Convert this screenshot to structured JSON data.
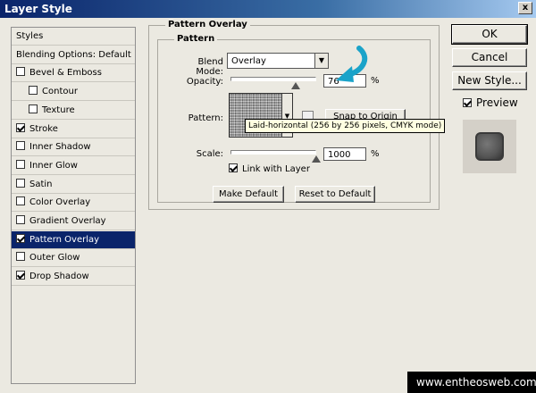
{
  "window": {
    "title": "Layer Style",
    "close_glyph": "x"
  },
  "style_list": {
    "items": [
      {
        "label": "Styles",
        "checkbox": false,
        "checked": false,
        "indent": false,
        "selected": false
      },
      {
        "label": "Blending Options: Default",
        "checkbox": false,
        "checked": false,
        "indent": false,
        "selected": false
      },
      {
        "label": "Bevel & Emboss",
        "checkbox": true,
        "checked": false,
        "indent": false,
        "selected": false
      },
      {
        "label": "Contour",
        "checkbox": true,
        "checked": false,
        "indent": true,
        "selected": false
      },
      {
        "label": "Texture",
        "checkbox": true,
        "checked": false,
        "indent": true,
        "selected": false
      },
      {
        "label": "Stroke",
        "checkbox": true,
        "checked": true,
        "indent": false,
        "selected": false
      },
      {
        "label": "Inner Shadow",
        "checkbox": true,
        "checked": false,
        "indent": false,
        "selected": false
      },
      {
        "label": "Inner Glow",
        "checkbox": true,
        "checked": false,
        "indent": false,
        "selected": false
      },
      {
        "label": "Satin",
        "checkbox": true,
        "checked": false,
        "indent": false,
        "selected": false
      },
      {
        "label": "Color Overlay",
        "checkbox": true,
        "checked": false,
        "indent": false,
        "selected": false
      },
      {
        "label": "Gradient Overlay",
        "checkbox": true,
        "checked": false,
        "indent": false,
        "selected": false
      },
      {
        "label": "Pattern Overlay",
        "checkbox": true,
        "checked": true,
        "indent": false,
        "selected": true
      },
      {
        "label": "Outer Glow",
        "checkbox": true,
        "checked": false,
        "indent": false,
        "selected": false
      },
      {
        "label": "Drop Shadow",
        "checkbox": true,
        "checked": true,
        "indent": false,
        "selected": false
      }
    ]
  },
  "panel": {
    "section_title": "Pattern Overlay",
    "group_title": "Pattern",
    "blend_mode": {
      "label": "Blend Mode:",
      "value": "Overlay"
    },
    "opacity": {
      "label": "Opacity:",
      "value": "76",
      "unit": "%",
      "level": 0.76
    },
    "pattern": {
      "label": "Pattern:",
      "snap_label": "Snap to Origin"
    },
    "tooltip": "Laid-horizontal (256 by 256 pixels, CMYK mode)",
    "scale": {
      "label": "Scale:",
      "value": "1000",
      "unit": "%",
      "level": 1.0
    },
    "link_with_layer": {
      "label": "Link with Layer",
      "checked": true
    },
    "make_default": "Make Default",
    "reset_default": "Reset to Default"
  },
  "right_buttons": {
    "ok": "OK",
    "cancel": "Cancel",
    "new_style": "New Style...",
    "preview_label": "Preview",
    "preview_checked": true
  },
  "watermark": "www.entheosweb.com",
  "colors": {
    "selection": "#0a246a",
    "arrow": "#1aa3c9",
    "tooltip_bg": "#ffffe1"
  }
}
